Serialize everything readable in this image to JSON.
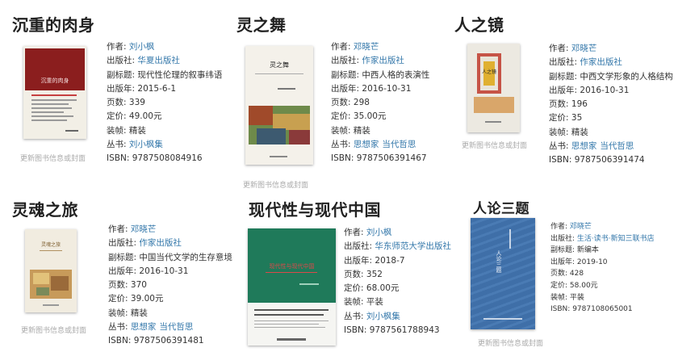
{
  "labels": {
    "author": "作者:",
    "publisher": "出版社:",
    "subtitle": "副标题:",
    "pubdate": "出版年:",
    "pages": "页数:",
    "price": "定价:",
    "binding": "装帧:",
    "series": "丛书:",
    "isbn": "ISBN:",
    "update_link": "更新图书信息或封面"
  },
  "books": [
    {
      "title": "沉重的肉身",
      "author": "刘小枫",
      "publisher": "华夏出版社",
      "subtitle": "现代性伦理的叙事纬语",
      "pubdate": "2015-6-1",
      "pages": "339",
      "price": "49.00元",
      "binding": "精装",
      "series": [
        "刘小枫集"
      ],
      "isbn": "9787508084916",
      "cover_text": "沉重的肉身"
    },
    {
      "title": "灵之舞",
      "author": "邓晓芒",
      "publisher": "作家出版社",
      "subtitle": "中西人格的表演性",
      "pubdate": "2016-10-31",
      "pages": "298",
      "price": "35.00元",
      "binding": "精装",
      "series": [
        "思想家",
        "当代哲思"
      ],
      "isbn": "9787506391467",
      "cover_text": "灵之舞"
    },
    {
      "title": "人之镜",
      "author": "邓晓芒",
      "publisher": "作家出版社",
      "subtitle": "中西文学形象的人格结构",
      "pubdate": "2016-10-31",
      "pages": "196",
      "price": "35",
      "binding": "精装",
      "series": [
        "思想家",
        "当代哲思"
      ],
      "isbn": "9787506391474",
      "cover_text": "人之镜"
    },
    {
      "title": "灵魂之旅",
      "author": "邓晓芒",
      "publisher": "作家出版社",
      "subtitle": "中国当代文学的生存意境",
      "pubdate": "2016-10-31",
      "pages": "370",
      "price": "39.00元",
      "binding": "精装",
      "series": [
        "思想家",
        "当代哲思"
      ],
      "isbn": "9787506391481",
      "cover_text": "灵魂之旅"
    },
    {
      "title": "现代性与现代中国",
      "author": "刘小枫",
      "publisher": "华东师范大学出版社",
      "pubdate": "2018-7",
      "pages": "352",
      "price": "68.00元",
      "binding": "平装",
      "series": [
        "刘小枫集"
      ],
      "isbn": "9787561788943",
      "cover_text": "现代性与现代中国"
    },
    {
      "title": "人论三题",
      "author": "邓晓芒",
      "publisher": "生活·读书·新知三联书店",
      "subtitle": "新编本",
      "pubdate": "2019-10",
      "pages": "428",
      "price": "58.00元",
      "binding": "平装",
      "isbn": "9787108065001",
      "cover_text": "人论三题"
    }
  ]
}
